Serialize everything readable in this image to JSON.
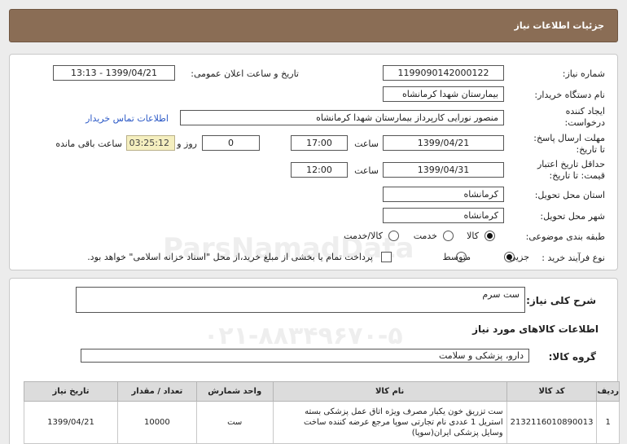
{
  "header": {
    "title": "جزئیات اطلاعات نیاز"
  },
  "fields": {
    "need_number_label": "شماره نیاز:",
    "need_number": "1199090142000122",
    "announce_label": "تاریخ و ساعت اعلان عمومی:",
    "announce_value": "1399/04/21 - 13:13",
    "buyer_label": "نام دستگاه خریدار:",
    "buyer_value": "بیمارستان شهدا کرمانشاه",
    "creator_label_1": "ایجاد کننده",
    "creator_label_2": "درخواست:",
    "creator_value": "منصور نورایی کارپرداز بیمارستان شهدا کرمانشاه",
    "contact_link": "اطلاعات تماس خریدار",
    "deadline_label_1": "مهلت ارسال پاسخ:",
    "deadline_label_2": "تا تاریخ:",
    "deadline_date": "1399/04/21",
    "time_label": "ساعت",
    "deadline_time": "17:00",
    "days_value": "0",
    "days_label": "روز و",
    "remaining_time": "03:25:12",
    "remaining_label": "ساعت باقی مانده",
    "validity_label_1": "حداقل تاریخ اعتبار",
    "validity_label_2": "قیمت: تا تاریخ:",
    "validity_date": "1399/04/31",
    "validity_time": "12:00",
    "province_label": "استان محل تحویل:",
    "province_value": "کرمانشاه",
    "city_label": "شهر محل تحویل:",
    "city_value": "کرمانشاه",
    "category_label": "طبقه بندی موضوعی:",
    "category_options": [
      "کالا",
      "خدمت",
      "کالا/خدمت"
    ],
    "category_selected": "کالا",
    "purchase_type_label": "نوع فرآیند خرید :",
    "purchase_options": [
      "جزیی",
      "متوسط"
    ],
    "purchase_selected": "جزیی",
    "payment_note": "پرداخت تمام یا بخشی از مبلغ خرید،از محل \"اسناد خزانه اسلامی\" خواهد بود."
  },
  "summary": {
    "desc_label": "شرح کلی نیاز:",
    "desc_value": "ست سرم",
    "goods_info_title": "اطلاعات کالاهای مورد نیاز",
    "group_label": "گروه کالا:",
    "group_value": "دارو، پزشکی و سلامت"
  },
  "table": {
    "headers": [
      "ردیف",
      "کد کالا",
      "نام کالا",
      "واحد شمارش",
      "تعداد / مقدار",
      "تاریخ نیاز"
    ],
    "rows": [
      {
        "index": "1",
        "code": "2132116010890013",
        "name_line1": "ست تزریق خون یکبار مصرف ویژه اتاق عمل پزشکی بسته",
        "name_line2": "استریل 1 عددی نام تجارتی سوپا مرجع عرضه کننده ساخت",
        "name_line3": "وسایل پزشکی ایران(سوپا)",
        "unit": "ست",
        "qty": "10000",
        "date": "1399/04/21"
      }
    ]
  }
}
